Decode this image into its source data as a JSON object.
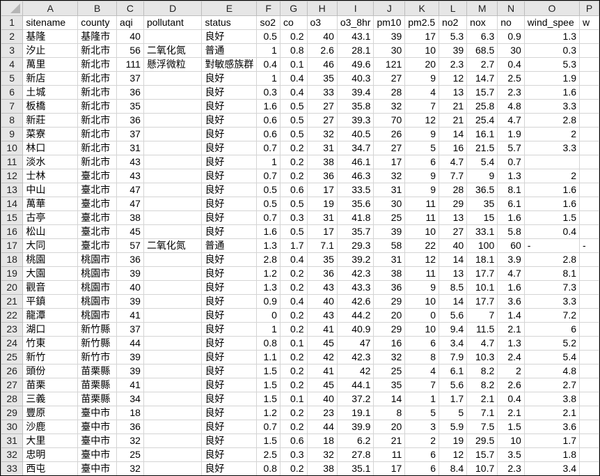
{
  "sheet": {
    "column_letters": [
      "A",
      "B",
      "C",
      "D",
      "E",
      "F",
      "G",
      "H",
      "I",
      "J",
      "K",
      "L",
      "M",
      "N",
      "O",
      "P"
    ],
    "header_row": [
      "sitename",
      "county",
      "aqi",
      "pollutant",
      "status",
      "so2",
      "co",
      "o3",
      "o3_8hr",
      "pm10",
      "pm2.5",
      "no2",
      "nox",
      "no",
      "wind_spee",
      "w"
    ],
    "rows": [
      [
        "基隆",
        "基隆市",
        "40",
        "",
        "良好",
        "0.5",
        "0.2",
        "40",
        "43.1",
        "39",
        "17",
        "5.3",
        "6.3",
        "0.9",
        "1.3",
        ""
      ],
      [
        "汐止",
        "新北市",
        "56",
        "二氧化氮",
        "普通",
        "1",
        "0.8",
        "2.6",
        "28.1",
        "30",
        "10",
        "39",
        "68.5",
        "30",
        "0.3",
        ""
      ],
      [
        "萬里",
        "新北市",
        "111",
        "懸浮微粒",
        "對敏感族群",
        "0.4",
        "0.1",
        "46",
        "49.6",
        "121",
        "20",
        "2.3",
        "2.7",
        "0.4",
        "5.3",
        ""
      ],
      [
        "新店",
        "新北市",
        "37",
        "",
        "良好",
        "1",
        "0.4",
        "35",
        "40.3",
        "27",
        "9",
        "12",
        "14.7",
        "2.5",
        "1.9",
        ""
      ],
      [
        "土城",
        "新北市",
        "36",
        "",
        "良好",
        "0.3",
        "0.4",
        "33",
        "39.4",
        "28",
        "4",
        "13",
        "15.7",
        "2.3",
        "1.6",
        ""
      ],
      [
        "板橋",
        "新北市",
        "35",
        "",
        "良好",
        "1.6",
        "0.5",
        "27",
        "35.8",
        "32",
        "7",
        "21",
        "25.8",
        "4.8",
        "3.3",
        ""
      ],
      [
        "新莊",
        "新北市",
        "36",
        "",
        "良好",
        "0.6",
        "0.5",
        "27",
        "39.3",
        "70",
        "12",
        "21",
        "25.4",
        "4.7",
        "2.8",
        ""
      ],
      [
        "菜寮",
        "新北市",
        "37",
        "",
        "良好",
        "0.6",
        "0.5",
        "32",
        "40.5",
        "26",
        "9",
        "14",
        "16.1",
        "1.9",
        "2",
        ""
      ],
      [
        "林口",
        "新北市",
        "31",
        "",
        "良好",
        "0.7",
        "0.2",
        "31",
        "34.7",
        "27",
        "5",
        "16",
        "21.5",
        "5.7",
        "3.3",
        ""
      ],
      [
        "淡水",
        "新北市",
        "43",
        "",
        "良好",
        "1",
        "0.2",
        "38",
        "46.1",
        "17",
        "6",
        "4.7",
        "5.4",
        "0.7",
        "",
        ""
      ],
      [
        "士林",
        "臺北市",
        "43",
        "",
        "良好",
        "0.7",
        "0.2",
        "36",
        "46.3",
        "32",
        "9",
        "7.7",
        "9",
        "1.3",
        "2",
        ""
      ],
      [
        "中山",
        "臺北市",
        "47",
        "",
        "良好",
        "0.5",
        "0.6",
        "17",
        "33.5",
        "31",
        "9",
        "28",
        "36.5",
        "8.1",
        "1.6",
        ""
      ],
      [
        "萬華",
        "臺北市",
        "47",
        "",
        "良好",
        "0.5",
        "0.5",
        "19",
        "35.6",
        "30",
        "11",
        "29",
        "35",
        "6.1",
        "1.6",
        ""
      ],
      [
        "古亭",
        "臺北市",
        "38",
        "",
        "良好",
        "0.7",
        "0.3",
        "31",
        "41.8",
        "25",
        "11",
        "13",
        "15",
        "1.6",
        "1.5",
        ""
      ],
      [
        "松山",
        "臺北市",
        "45",
        "",
        "良好",
        "1.6",
        "0.5",
        "17",
        "35.7",
        "39",
        "10",
        "27",
        "33.1",
        "5.8",
        "0.4",
        ""
      ],
      [
        "大同",
        "臺北市",
        "57",
        "二氧化氮",
        "普通",
        "1.3",
        "1.7",
        "7.1",
        "29.3",
        "58",
        "22",
        "40",
        "100",
        "60",
        "-",
        "-"
      ],
      [
        "桃園",
        "桃園市",
        "36",
        "",
        "良好",
        "2.8",
        "0.4",
        "35",
        "39.2",
        "31",
        "12",
        "14",
        "18.1",
        "3.9",
        "2.8",
        ""
      ],
      [
        "大園",
        "桃園市",
        "39",
        "",
        "良好",
        "1.2",
        "0.2",
        "36",
        "42.3",
        "38",
        "11",
        "13",
        "17.7",
        "4.7",
        "8.1",
        ""
      ],
      [
        "觀音",
        "桃園市",
        "40",
        "",
        "良好",
        "1.3",
        "0.2",
        "43",
        "43.3",
        "36",
        "9",
        "8.5",
        "10.1",
        "1.6",
        "7.3",
        ""
      ],
      [
        "平鎮",
        "桃園市",
        "39",
        "",
        "良好",
        "0.9",
        "0.4",
        "40",
        "42.6",
        "29",
        "10",
        "14",
        "17.7",
        "3.6",
        "3.3",
        ""
      ],
      [
        "龍潭",
        "桃園市",
        "41",
        "",
        "良好",
        "0",
        "0.2",
        "43",
        "44.2",
        "20",
        "0",
        "5.6",
        "7",
        "1.4",
        "7.2",
        ""
      ],
      [
        "湖口",
        "新竹縣",
        "37",
        "",
        "良好",
        "1",
        "0.2",
        "41",
        "40.9",
        "29",
        "10",
        "9.4",
        "11.5",
        "2.1",
        "6",
        ""
      ],
      [
        "竹東",
        "新竹縣",
        "44",
        "",
        "良好",
        "0.8",
        "0.1",
        "45",
        "47",
        "16",
        "6",
        "3.4",
        "4.7",
        "1.3",
        "5.2",
        ""
      ],
      [
        "新竹",
        "新竹市",
        "39",
        "",
        "良好",
        "1.1",
        "0.2",
        "42",
        "42.3",
        "32",
        "8",
        "7.9",
        "10.3",
        "2.4",
        "5.4",
        ""
      ],
      [
        "頭份",
        "苗栗縣",
        "39",
        "",
        "良好",
        "1.5",
        "0.2",
        "41",
        "42",
        "25",
        "4",
        "6.1",
        "8.2",
        "2",
        "4.8",
        ""
      ],
      [
        "苗栗",
        "苗栗縣",
        "41",
        "",
        "良好",
        "1.5",
        "0.2",
        "45",
        "44.1",
        "35",
        "7",
        "5.6",
        "8.2",
        "2.6",
        "2.7",
        ""
      ],
      [
        "三義",
        "苗栗縣",
        "34",
        "",
        "良好",
        "1.5",
        "0.1",
        "40",
        "37.2",
        "14",
        "1",
        "1.7",
        "2.1",
        "0.4",
        "3.8",
        ""
      ],
      [
        "豐原",
        "臺中市",
        "18",
        "",
        "良好",
        "1.2",
        "0.2",
        "23",
        "19.1",
        "8",
        "5",
        "5",
        "7.1",
        "2.1",
        "2.1",
        ""
      ],
      [
        "沙鹿",
        "臺中市",
        "36",
        "",
        "良好",
        "0.7",
        "0.2",
        "44",
        "39.9",
        "20",
        "3",
        "5.9",
        "7.5",
        "1.5",
        "3.6",
        ""
      ],
      [
        "大里",
        "臺中市",
        "32",
        "",
        "良好",
        "1.5",
        "0.6",
        "18",
        "6.2",
        "21",
        "2",
        "19",
        "29.5",
        "10",
        "1.7",
        ""
      ],
      [
        "忠明",
        "臺中市",
        "25",
        "",
        "良好",
        "2.5",
        "0.3",
        "32",
        "27.8",
        "11",
        "6",
        "12",
        "15.7",
        "3.5",
        "1.8",
        ""
      ],
      [
        "西屯",
        "臺中市",
        "32",
        "",
        "良好",
        "0.8",
        "0.2",
        "38",
        "35.1",
        "17",
        "6",
        "8.4",
        "10.7",
        "2.3",
        "3.4",
        ""
      ]
    ]
  }
}
